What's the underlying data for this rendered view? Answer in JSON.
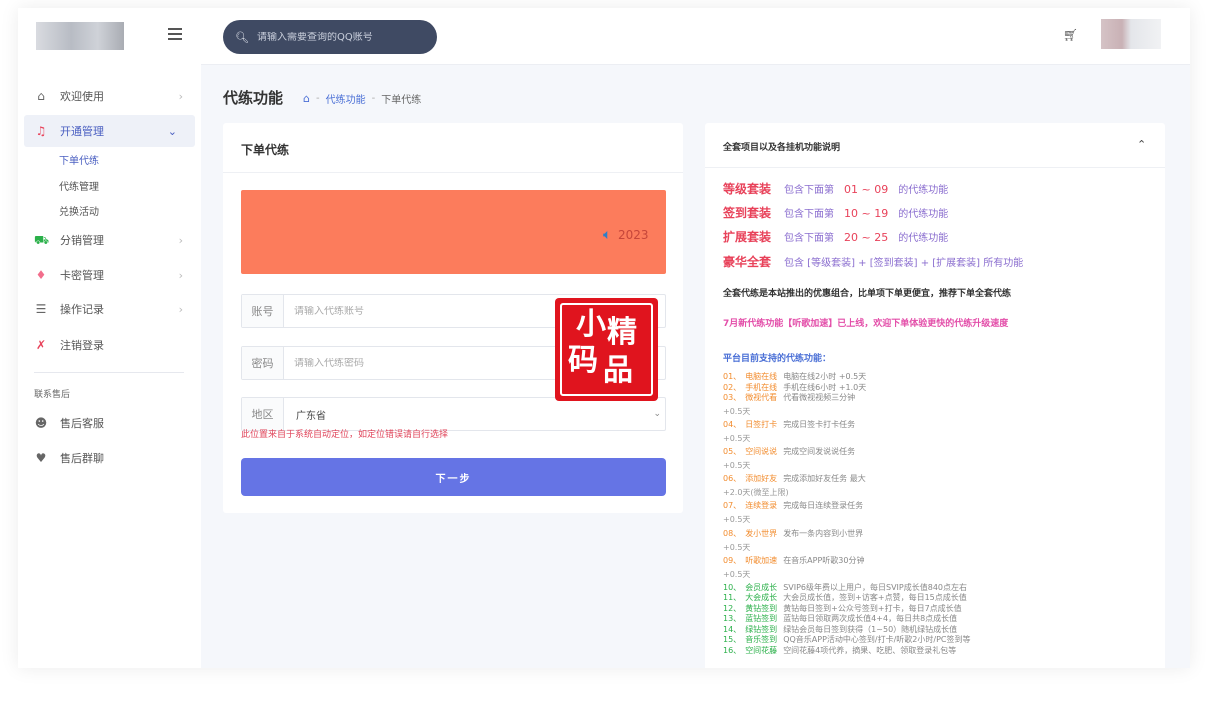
{
  "sidebar": {
    "items": [
      {
        "label": "欢迎使用",
        "icon": "home-icon"
      },
      {
        "label": "开通管理",
        "icon": "music-icon"
      },
      {
        "label": "分销管理",
        "icon": "cart-icon"
      },
      {
        "label": "卡密管理",
        "icon": "diamond-icon"
      },
      {
        "label": "操作记录",
        "icon": "list-icon"
      },
      {
        "label": "注销登录",
        "icon": "logout-icon"
      }
    ],
    "sub_items": [
      "下单代练",
      "代练管理",
      "兑换活动"
    ],
    "section_label": "联系售后",
    "support_items": [
      {
        "label": "售后客服",
        "icon": "smile-icon"
      },
      {
        "label": "售后群聊",
        "icon": "heart-icon"
      }
    ]
  },
  "topbar": {
    "search_placeholder": "请输入需要查询的QQ账号"
  },
  "page": {
    "title": "代练功能",
    "breadcrumb": [
      "代练功能",
      "下单代练"
    ]
  },
  "order_form": {
    "title": "下单代练",
    "banner_text": "2023",
    "account_label": "账号",
    "account_placeholder": "请输入代练账号",
    "password_label": "密码",
    "password_placeholder": "请输入代练密码",
    "region_label": "地区",
    "region_value": "广东省",
    "hint": "此位置来自于系统自动定位，如定位错误请自行选择",
    "next_button": "下一步"
  },
  "seal": {
    "chars": [
      "小",
      "精",
      "码",
      "品"
    ]
  },
  "info_panel": {
    "title": "全套项目以及各挂机功能说明",
    "packages": [
      {
        "name": "等级套装",
        "prefix": "包含下面第",
        "range": "01 ~ 09",
        "suffix": "的代练功能"
      },
      {
        "name": "签到套装",
        "prefix": "包含下面第",
        "range": "10 ~ 19",
        "suffix": "的代练功能"
      },
      {
        "name": "扩展套装",
        "prefix": "包含下面第",
        "range": "20 ~ 25",
        "suffix": "的代练功能"
      },
      {
        "name": "豪华全套",
        "prefix": "包含 [等级套装] + [签到套装] + [扩展套装] 所有功能",
        "range": "",
        "suffix": ""
      }
    ],
    "note_bold": "全套代练是本站推出的优惠组合，比单项下单更便宜，推荐下单全套代练",
    "note_pink": "7月新代练功能【听歌加速】已上线，欢迎下单体验更快的代练升级速度",
    "support_title": "平台目前支持的代练功能：",
    "features": [
      {
        "num": "01、",
        "name": "电脑在线",
        "desc": "电脑在线2小时 +0.5天",
        "cont": ""
      },
      {
        "num": "02、",
        "name": "手机在线",
        "desc": "手机在线6小时 +1.0天",
        "cont": ""
      },
      {
        "num": "03、",
        "name": "微视代看",
        "desc": "代看微视视频三分钟",
        "cont": "+0.5天"
      },
      {
        "num": "04、",
        "name": "日签打卡",
        "desc": "完成日签卡打卡任务",
        "cont": "+0.5天"
      },
      {
        "num": "05、",
        "name": "空间说说",
        "desc": "完成空间发说说任务",
        "cont": "+0.5天"
      },
      {
        "num": "06、",
        "name": "添加好友",
        "desc": "完成添加好友任务 最大",
        "cont": "+2.0天(微至上限)"
      },
      {
        "num": "07、",
        "name": "连续登录",
        "desc": "完成每日连续登录任务",
        "cont": "+0.5天"
      },
      {
        "num": "08、",
        "name": "发小世界",
        "desc": "发布一条内容到小世界",
        "cont": "+0.5天"
      },
      {
        "num": "09、",
        "name": "听歌加速",
        "desc": "在音乐APP听歌30分钟",
        "cont": "+0.5天"
      },
      {
        "num": "10、",
        "name": "会员成长",
        "desc": "SVIP6级年费以上用户，每日SVIP成长值840点左右",
        "cont": ""
      },
      {
        "num": "11、",
        "name": "大会成长",
        "desc": "大会员成长值，签到+访客+点赞，每日15点成长值",
        "cont": ""
      },
      {
        "num": "12、",
        "name": "黄钻签到",
        "desc": "黄钻每日签到+公众号签到+打卡，每日7点成长值",
        "cont": ""
      },
      {
        "num": "13、",
        "name": "蓝钻签到",
        "desc": "蓝钻每日领取两次成长值4+4，每日共8点成长值",
        "cont": ""
      },
      {
        "num": "14、",
        "name": "绿钻签到",
        "desc": "绿钻会员每日签到获得（1~50）随机绿钻成长值",
        "cont": ""
      },
      {
        "num": "15、",
        "name": "音乐签到",
        "desc": "QQ音乐APP活动中心签到/打卡/听歌2小时/PC签到等",
        "cont": ""
      },
      {
        "num": "16、",
        "name": "空间花藤",
        "desc": "空间花藤4项代养，摘果、吃肥、领取登录礼包等",
        "cont": ""
      }
    ]
  }
}
